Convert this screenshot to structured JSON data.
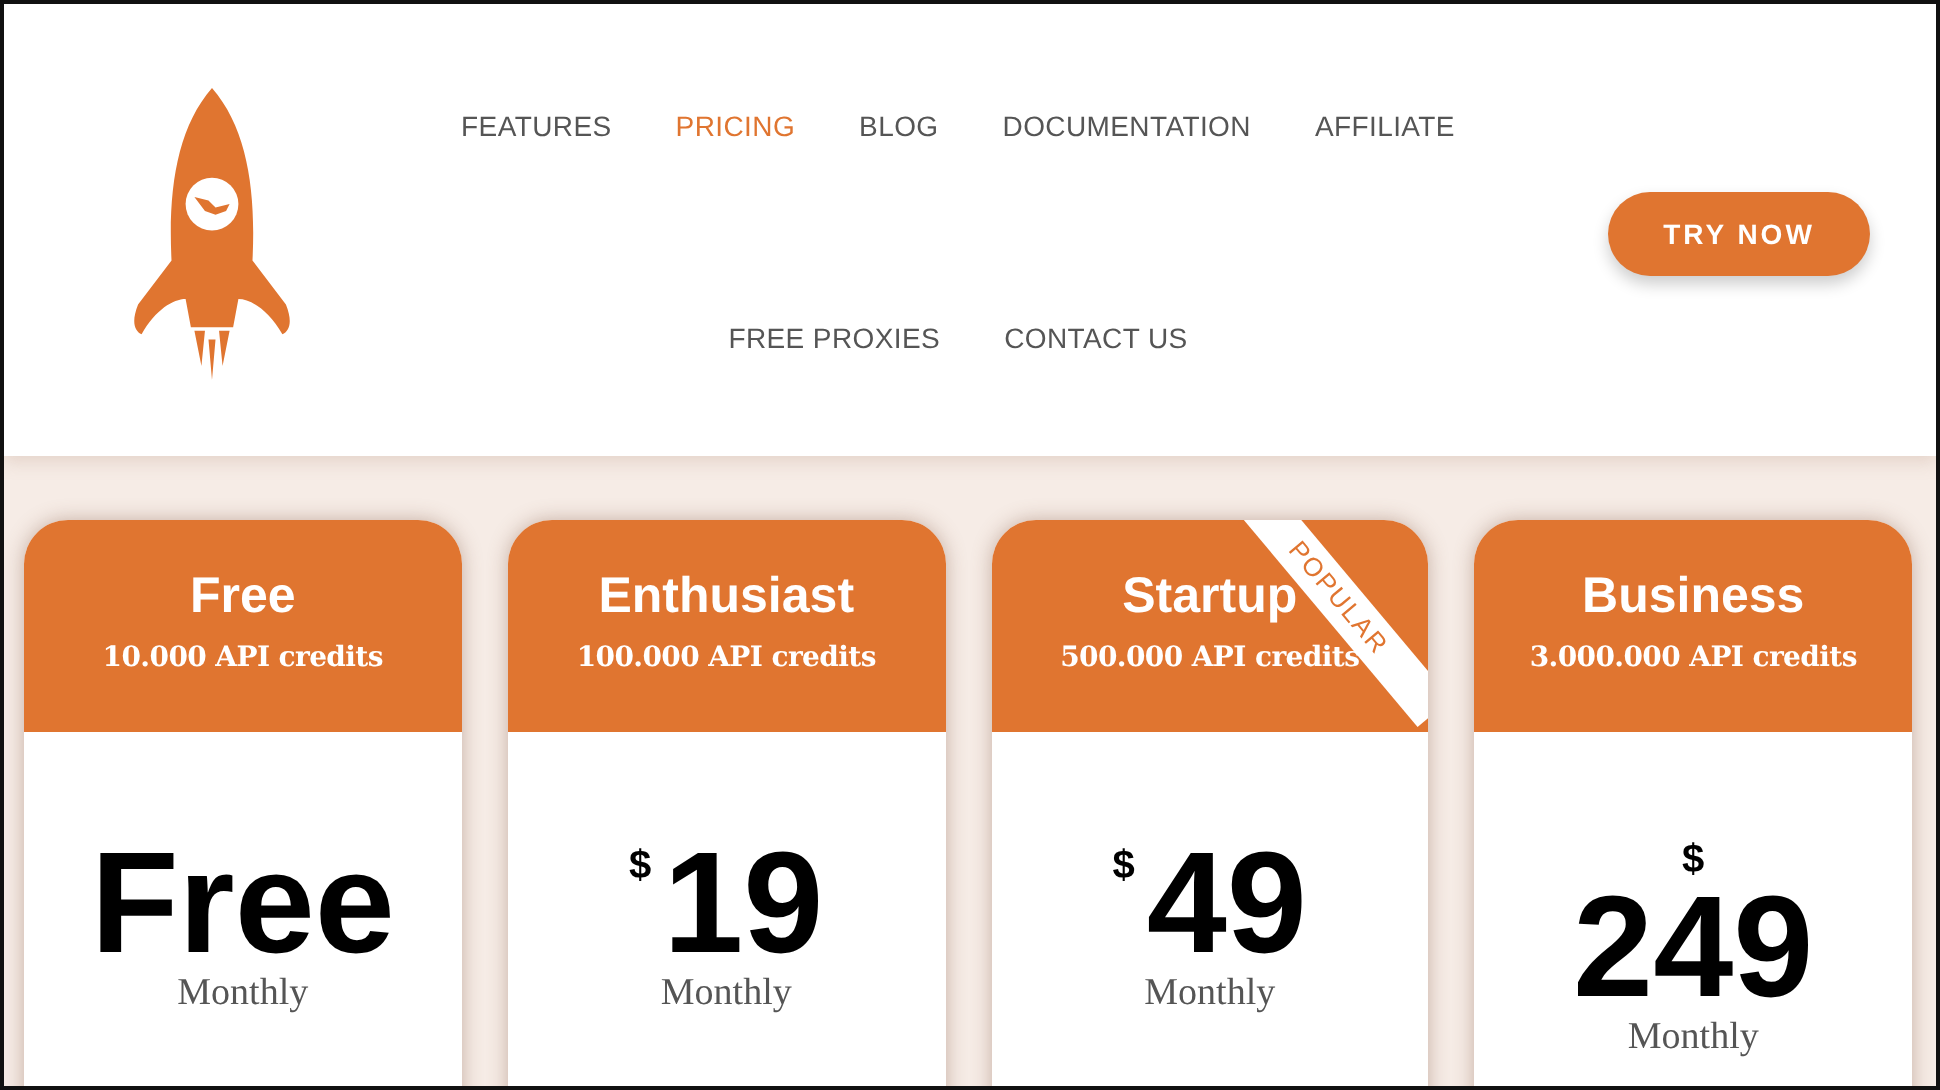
{
  "nav": {
    "items": [
      {
        "label": "FEATURES",
        "selected": false
      },
      {
        "label": "PRICING",
        "selected": true
      },
      {
        "label": "BLOG",
        "selected": false
      },
      {
        "label": "DOCUMENTATION",
        "selected": false
      },
      {
        "label": "AFFILIATE",
        "selected": false
      },
      {
        "label": "FREE PROXIES",
        "selected": false
      },
      {
        "label": "CONTACT US",
        "selected": false
      }
    ]
  },
  "cta": "TRY NOW",
  "plans": [
    {
      "name": "Free",
      "credits": "10.000 API credits",
      "kind": "inline",
      "price": "Free",
      "period": "Monthly"
    },
    {
      "name": "Enthusiast",
      "credits": "100.000 API credits",
      "kind": "inline",
      "currency": "$",
      "price": "19",
      "period": "Monthly"
    },
    {
      "name": "Startup",
      "credits": "500.000 API credits",
      "kind": "inline",
      "currency": "$",
      "price": "49",
      "period": "Monthly",
      "badge": "POPULAR"
    },
    {
      "name": "Business",
      "credits": "3.000.000 API credits",
      "kind": "stacked",
      "currency": "$",
      "price": "249",
      "period": "Monthly"
    }
  ]
}
